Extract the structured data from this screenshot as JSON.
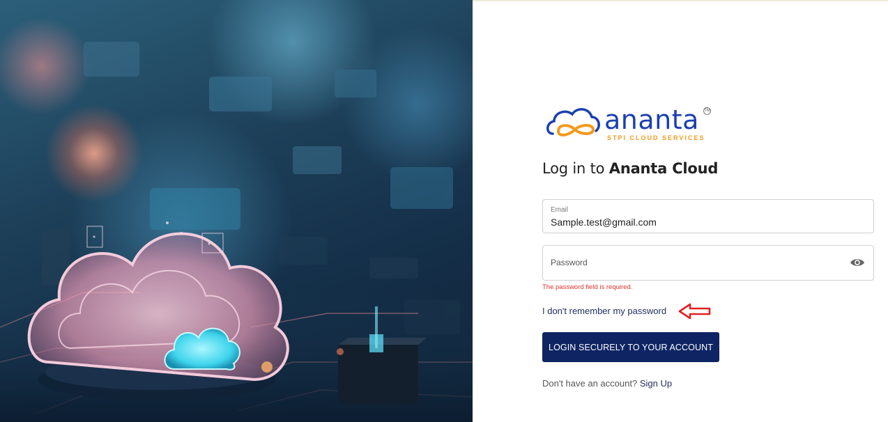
{
  "hero": {
    "illustration": "glowing-cloud-on-circuit-board"
  },
  "brand": {
    "logo_text": "ananta",
    "logo_tagline": "STPI CLOUD SERVICES",
    "trademark": "TM",
    "colors": {
      "blue": "#1c3fb0",
      "orange": "#f29a1b",
      "navy": "#0e2463"
    }
  },
  "login": {
    "title_prefix": "Log in to ",
    "title_brand": "Ananta Cloud",
    "email": {
      "label": "Email",
      "value": "Sample.test@gmail.com"
    },
    "password": {
      "label": "Password",
      "value": "",
      "toggle_icon": "eye-icon"
    },
    "error": "The password field is required.",
    "forgot_link": "I don't remember my password",
    "submit_label": "LOGIN SECURELY TO YOUR ACCOUNT",
    "signup_prompt": "Don't have an account?",
    "signup_link": "Sign Up"
  },
  "annotation": {
    "icon": "red-arrow-left-icon",
    "color": "#e02020"
  }
}
